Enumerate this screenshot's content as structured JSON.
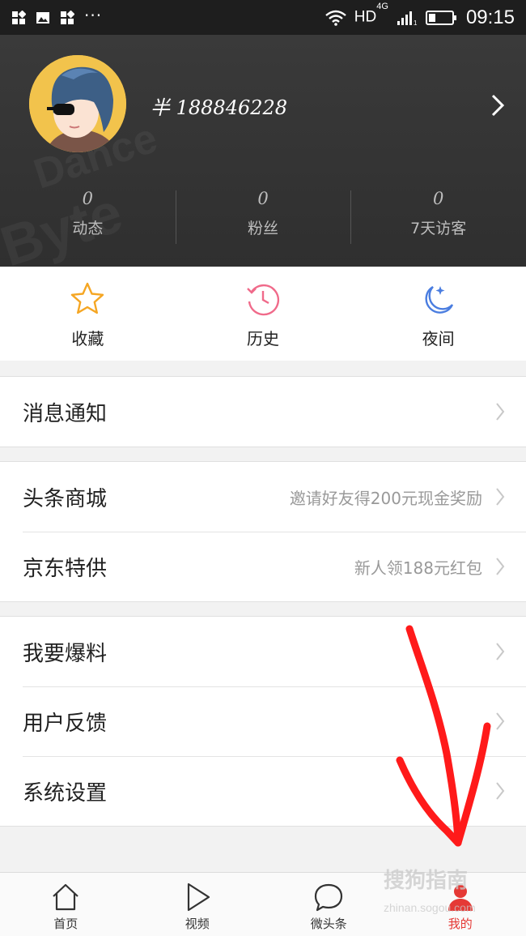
{
  "status_bar": {
    "dots": "···",
    "network": "HD",
    "network_sup": "4G",
    "time": "09:15"
  },
  "profile": {
    "username": "半 188846228",
    "background_text": [
      "Dance",
      "Byte"
    ],
    "stats": [
      {
        "value": "0",
        "label": "动态"
      },
      {
        "value": "0",
        "label": "粉丝"
      },
      {
        "value": "0",
        "label": "7天访客"
      }
    ]
  },
  "quick_actions": [
    {
      "label": "收藏",
      "icon": "star-icon",
      "color": "#f5a623"
    },
    {
      "label": "历史",
      "icon": "history-clock-icon",
      "color": "#f06a8a"
    },
    {
      "label": "夜间",
      "icon": "moon-icon",
      "color": "#4a7de0"
    }
  ],
  "menu_groups": [
    {
      "items": [
        {
          "label": "消息通知",
          "hint": ""
        }
      ]
    },
    {
      "items": [
        {
          "label": "头条商城",
          "hint": "邀请好友得200元现金奖励"
        },
        {
          "label": "京东特供",
          "hint": "新人领188元红包"
        }
      ]
    },
    {
      "items": [
        {
          "label": "我要爆料",
          "hint": ""
        },
        {
          "label": "用户反馈",
          "hint": ""
        },
        {
          "label": "系统设置",
          "hint": ""
        }
      ]
    }
  ],
  "bottom_nav": [
    {
      "label": "首页",
      "icon": "home-icon",
      "active": false
    },
    {
      "label": "视频",
      "icon": "play-icon",
      "active": false
    },
    {
      "label": "微头条",
      "icon": "chat-bubble-icon",
      "active": false
    },
    {
      "label": "我的",
      "icon": "person-icon",
      "active": true
    }
  ],
  "watermark": {
    "text": "搜狗指南",
    "url": "zhinan.sogou.com"
  },
  "colors": {
    "accent_red": "#e53935",
    "annotation_red": "#ff1a1a",
    "header_bg": "#333333"
  }
}
